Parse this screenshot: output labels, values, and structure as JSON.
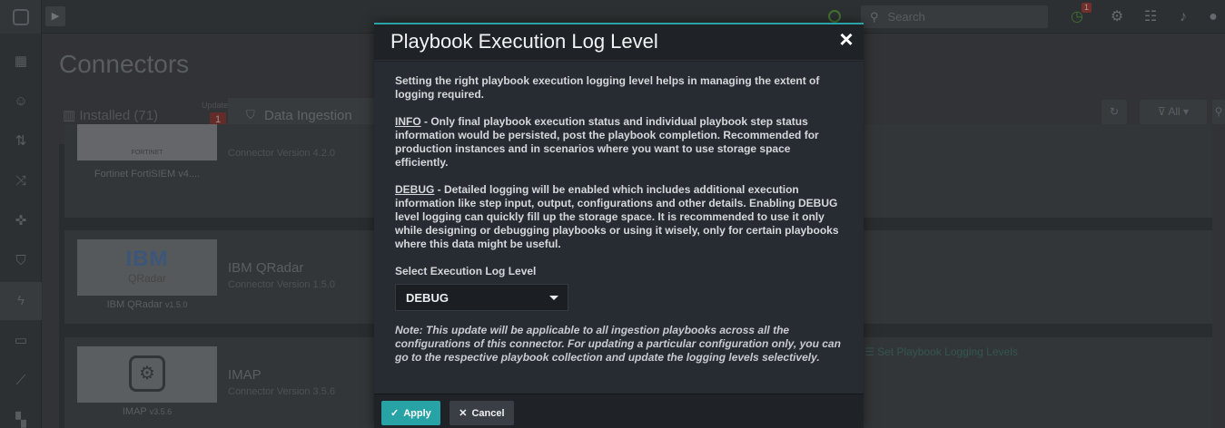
{
  "topbar": {
    "search_placeholder": "Search",
    "alert_badge": "1"
  },
  "page": {
    "title": "Connectors",
    "tabs": {
      "installed": "Installed (71)",
      "updates_label": "Updates",
      "updates_count": "1",
      "ingestion": "Data Ingestion"
    },
    "filter_label": "All"
  },
  "cards": [
    {
      "thumb_text": "FORTINET",
      "name": "Fortinet FortiSIEM v4....",
      "title": "",
      "version": "Connector Version 4.2.0"
    },
    {
      "thumb_text": "IBM",
      "thumb_sub": "QRadar",
      "name": "IBM QRadar",
      "name_ver": "v1.5.0",
      "title": "IBM QRadar",
      "version": "Connector Version 1.5.0"
    },
    {
      "name": "IMAP",
      "name_ver": "v3.5.6",
      "title": "IMAP",
      "version": "Connector Version 3.5.6",
      "action": "Set Playbook Logging Levels"
    }
  ],
  "modal": {
    "title": "Playbook Execution Log Level",
    "close": "×",
    "intro": "Setting the right playbook execution logging level helps in managing the extent of logging required.",
    "info_term": "INFO",
    "info_text": " - Only final playbook execution status and individual playbook step status information would be persisted, post the playbook completion. Recommended for production instances and in scenarios where you want to use storage space efficiently.",
    "debug_term": "DEBUG",
    "debug_text": " - Detailed logging will be enabled which includes additional execution information like step input, output, configurations and other details. Enabling DEBUG level logging can quickly fill up the storage space. It is recommended to use it only while designing or debugging playbooks or using it wisely, only for certain playbooks where this data might be useful.",
    "select_label": "Select Execution Log Level",
    "select_value": "DEBUG",
    "note": "Note: This update will be applicable to all ingestion playbooks across all the configurations of this connector. For updating a particular configuration only, you can go to the respective playbook collection and update the logging levels selectively.",
    "apply_label": "Apply",
    "cancel_label": "Cancel"
  },
  "colors": {
    "accent": "#27a2a5",
    "modal_bg": "#272c33",
    "header_bg": "#1f2328"
  }
}
